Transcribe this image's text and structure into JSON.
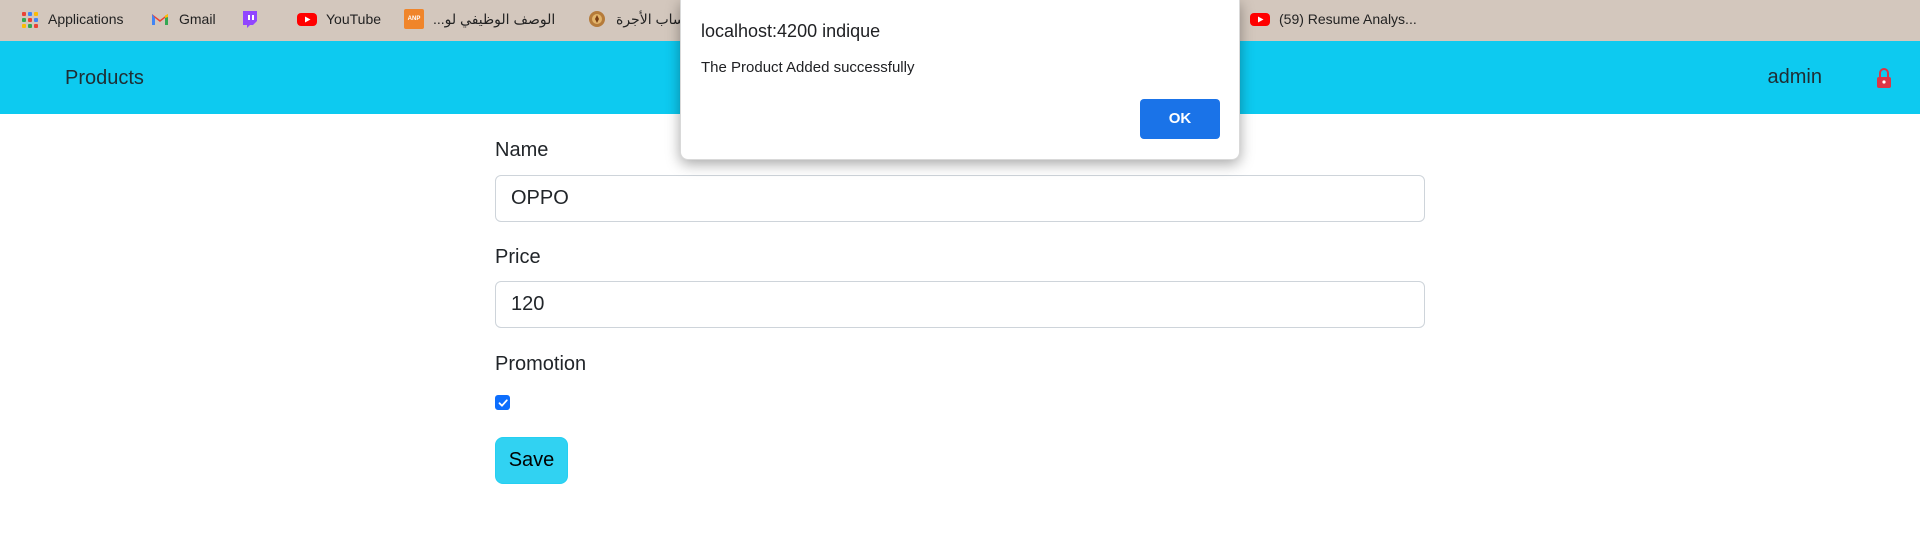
{
  "bookmarks": [
    {
      "label": "Applications",
      "icon": "apps-grid-icon"
    },
    {
      "label": "Gmail",
      "icon": "gmail-icon"
    },
    {
      "label": "",
      "icon": "twitch-icon"
    },
    {
      "label": "YouTube",
      "icon": "youtube-icon"
    },
    {
      "label": "الوصف الوظيفي لو...",
      "icon": "orange-site-icon"
    },
    {
      "label": "ساب الأجرة",
      "icon": "seal-icon"
    },
    {
      "label": "(59) Resume Analys...",
      "icon": "youtube-icon"
    }
  ],
  "navbar": {
    "brand": "Products",
    "user": "admin",
    "color": "#0dcaf0"
  },
  "form": {
    "name_label": "Name",
    "name_value": "OPPO",
    "price_label": "Price",
    "price_value": "120",
    "promotion_label": "Promotion",
    "promotion_checked": true,
    "save_label": "Save"
  },
  "dialog": {
    "title": "localhost:4200 indique",
    "message": "The Product Added successfully",
    "ok_label": "OK"
  }
}
